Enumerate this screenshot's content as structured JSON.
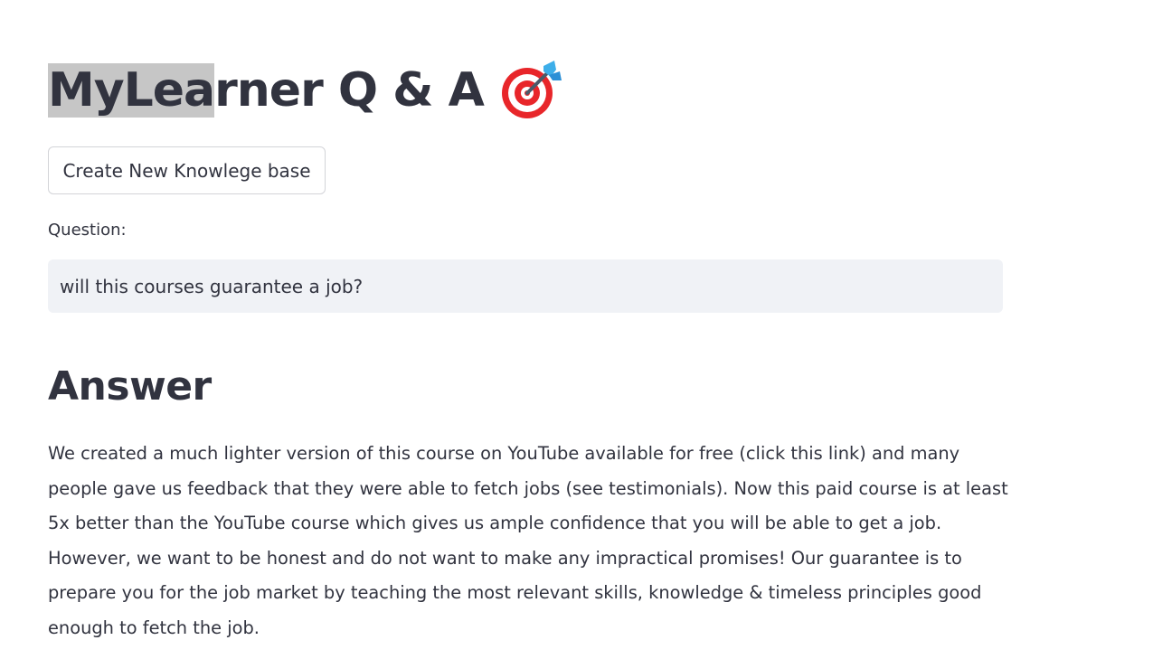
{
  "title": {
    "highlighted": "MyLea",
    "rest": "rner Q & A",
    "icon": "target-dart-icon"
  },
  "kb_button_label": "Create New Knowlege base",
  "question": {
    "label": "Question:",
    "value": "will this courses guarantee a job?"
  },
  "answer": {
    "heading": "Answer",
    "text": "We created a much lighter version of this course on YouTube available for free (click this link) and many people gave us feedback that they were able to fetch jobs (see testimonials). Now this paid course is at least 5x better than the YouTube course which gives us ample confidence that you will be able to get a job. However, we want to be honest and do not want to make any impractical promises! Our guarantee is to prepare you for the job market by teaching the most relevant skills, knowledge & timeless principles good enough to fetch the job."
  },
  "colors": {
    "text": "#31333f",
    "input_bg": "#f0f2f6",
    "highlight": "#c6c6c6",
    "target_red": "#e8262a",
    "dart_blue": "#3daee9"
  }
}
